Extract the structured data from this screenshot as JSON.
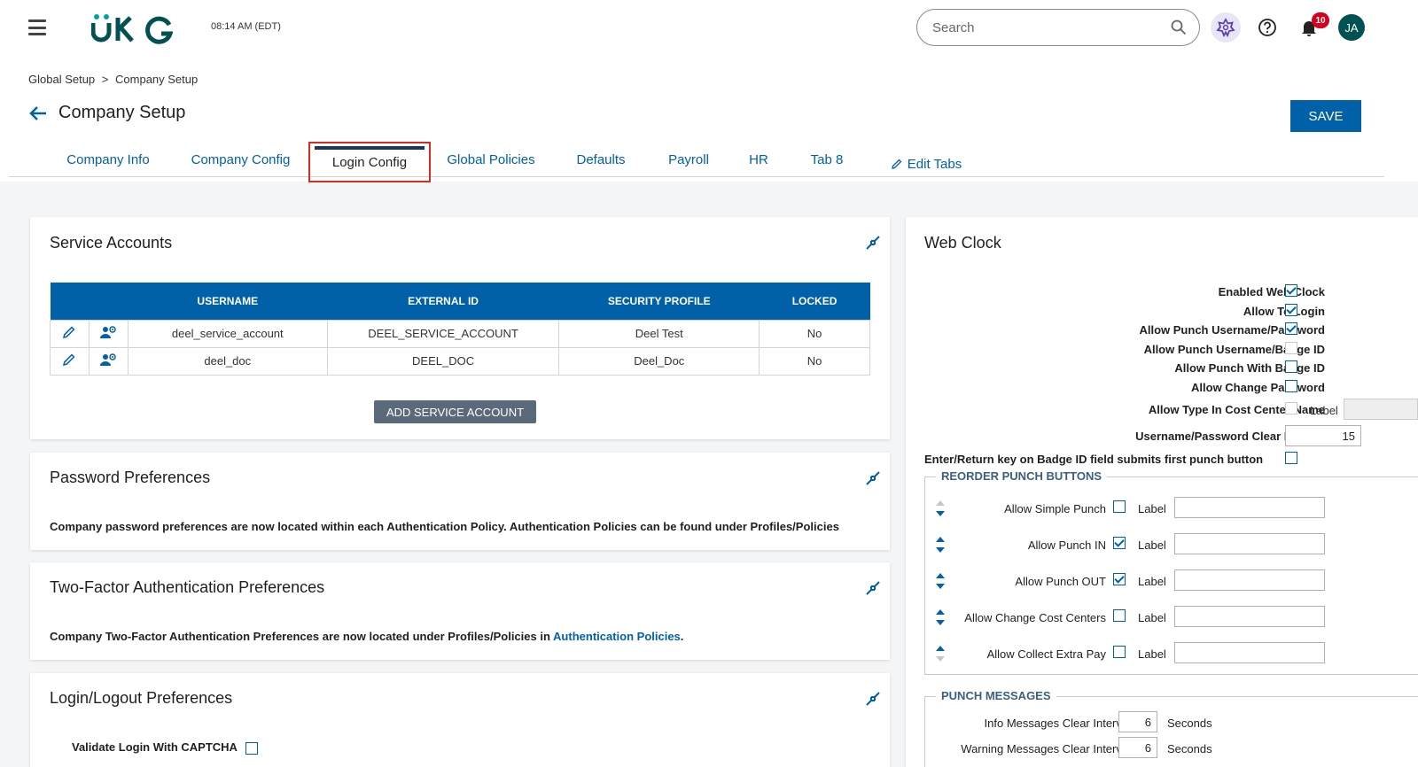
{
  "header": {
    "time": "08:14 AM (EDT)",
    "search_placeholder": "Search",
    "notification_count": "10",
    "avatar_initials": "JA"
  },
  "breadcrumb": {
    "items": [
      "Global Setup",
      ">",
      "Company Setup"
    ]
  },
  "page": {
    "title": "Company Setup",
    "save_label": "SAVE"
  },
  "tabs": [
    {
      "label": "Company Info"
    },
    {
      "label": "Company Config"
    },
    {
      "label": "Login Config",
      "active": true
    },
    {
      "label": "Global Policies"
    },
    {
      "label": "Defaults"
    },
    {
      "label": "Payroll"
    },
    {
      "label": "HR"
    },
    {
      "label": "Tab 8"
    },
    {
      "label": "Edit Tabs"
    }
  ],
  "service_accounts": {
    "title": "Service Accounts",
    "columns": [
      "USERNAME",
      "EXTERNAL ID",
      "SECURITY PROFILE",
      "LOCKED"
    ],
    "rows": [
      {
        "username": "deel_service_account",
        "external_id": "DEEL_SERVICE_ACCOUNT",
        "security_profile": "Deel Test",
        "locked": "No"
      },
      {
        "username": "deel_doc",
        "external_id": "DEEL_DOC",
        "security_profile": "Deel_Doc",
        "locked": "No"
      }
    ],
    "add_label": "ADD SERVICE ACCOUNT"
  },
  "password_prefs": {
    "title": "Password Preferences",
    "text": "Company password preferences are now located within each Authentication Policy. Authentication Policies can be found under Profiles/Policies"
  },
  "two_factor": {
    "title": "Two-Factor Authentication Preferences",
    "text": "Company Two-Factor Authentication Preferences are now located under Profiles/Policies in",
    "link": "Authentication Policies",
    "suffix": "."
  },
  "login_logout": {
    "title": "Login/Logout Preferences",
    "captcha_label": "Validate Login With CAPTCHA"
  },
  "web_clock": {
    "title": "Web Clock",
    "options": [
      {
        "label": "Enabled Web Clock",
        "checked": true
      },
      {
        "label": "Allow To Login",
        "checked": true
      },
      {
        "label": "Allow Punch Username/Password",
        "checked": true
      },
      {
        "label": "Allow Punch Username/Badge ID",
        "checked": false,
        "disabled": true
      },
      {
        "label": "Allow Punch With Badge ID",
        "checked": false
      },
      {
        "label": "Allow Change Password",
        "checked": false
      }
    ],
    "cost_center_label": "Allow Type In Cost Center Name",
    "label_word": "Label",
    "clear_interval_label": "Username/Password Clear Interval",
    "clear_interval_value": "15",
    "enter_key_label": "Enter/Return key on Badge ID field submits first punch button",
    "reorder_title": "REORDER PUNCH BUTTONS",
    "punch_buttons": [
      {
        "label": "Allow Simple Punch",
        "checked": false
      },
      {
        "label": "Allow Punch IN",
        "checked": true
      },
      {
        "label": "Allow Punch OUT",
        "checked": true
      },
      {
        "label": "Allow Change Cost Centers",
        "checked": false
      },
      {
        "label": "Allow Collect Extra Pay",
        "checked": false
      }
    ],
    "messages_title": "PUNCH MESSAGES",
    "info_label": "Info Messages Clear Interval",
    "info_value": "6",
    "warning_label": "Warning Messages Clear Interval",
    "warning_value": "6",
    "seconds": "Seconds"
  }
}
